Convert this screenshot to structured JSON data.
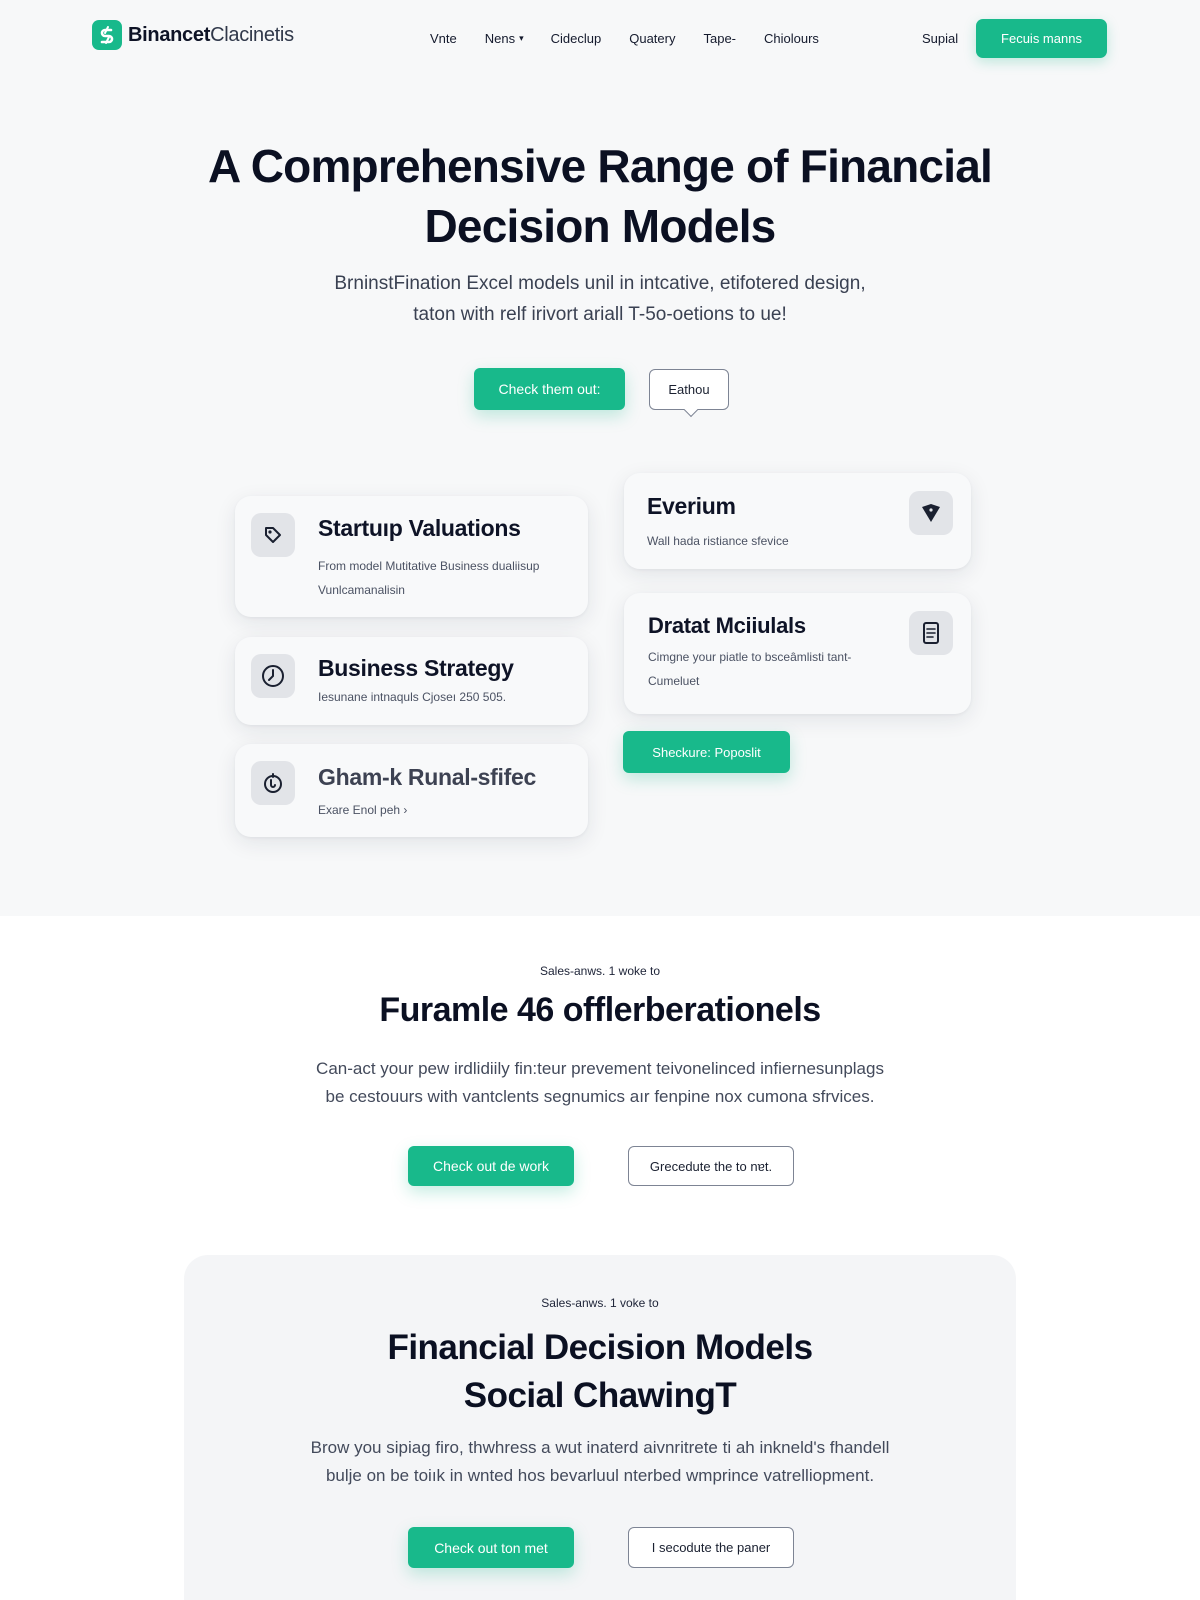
{
  "brand": {
    "name_bold": "Binancet",
    "name_light": "Clacinetis",
    "accent": "#18b98b",
    "logo_icon": "dollar-s-icon"
  },
  "nav": {
    "links": [
      "Vnte",
      "Nens",
      "Cideclup",
      "Quatery",
      "Tape-",
      "Chiolours"
    ],
    "signin": "Supial",
    "cta": "Fecuis manns"
  },
  "hero": {
    "title": "A Comprehensive Range of Financial Decision Models",
    "subtitle_line1": "BrninstFination Excel models unil in intcative, etifotered design,",
    "subtitle_line2": "taton with relf irivort ariall T-5o-oetions to ue!",
    "cta_primary": "Check them out:",
    "cta_secondary": "Eathou"
  },
  "cards": [
    {
      "title": "Startuıp Valuations",
      "desc": "From model Mutitative Business dualiisup\nVunlcamanalisin",
      "icon": "tag-icon"
    },
    {
      "title": "Business Strategy",
      "desc": "Iesunane intnaquls Cjoseı 250 505.",
      "icon": "clock-icon"
    },
    {
      "title": "Gham-k Runal-sfifec",
      "desc": "Exare Enol peh ›",
      "icon": "hand-coin-icon"
    },
    {
      "title": "Everium",
      "desc": "Wall hada ristiance sfevice",
      "icon": "shield-drop-icon"
    },
    {
      "title": "Dratat Mciiulals",
      "desc": "Cimgne your piatle to bsceâmlisti tant-\nCumeluet",
      "icon": "document-icon"
    }
  ],
  "cards_cta": "Sheckure: Poposlit",
  "section2": {
    "eyebrow": "Sales-anws. 1 woke to",
    "title": "Furamle 46 offlerberationels",
    "text_line1": "Can-act your pew irdlidiily fin:teur prevement teivonelinced infiernesunplags",
    "text_line2": "be cestouurs with vantclents segnumics aır fenpine nox cumona sfrvices.",
    "cta_primary": "Check out de work",
    "cta_secondary": "Grecedute the to nɐt."
  },
  "section3": {
    "eyebrow": "Sales-anws. 1 voke to",
    "title_line1": "Financial Decision Models",
    "title_line2": "Social ChawingT",
    "text_line1": "Brow you sipiag firo, thwhress a wut inaterd aivnritrete ti ah inkneld's fhandell",
    "text_line2": "bulje on be toiık in wnted hos bevarluul nterbed wmprince vatrelliopment.",
    "cta_primary": "Check out ton met",
    "cta_secondary": "I secodute the paner"
  }
}
